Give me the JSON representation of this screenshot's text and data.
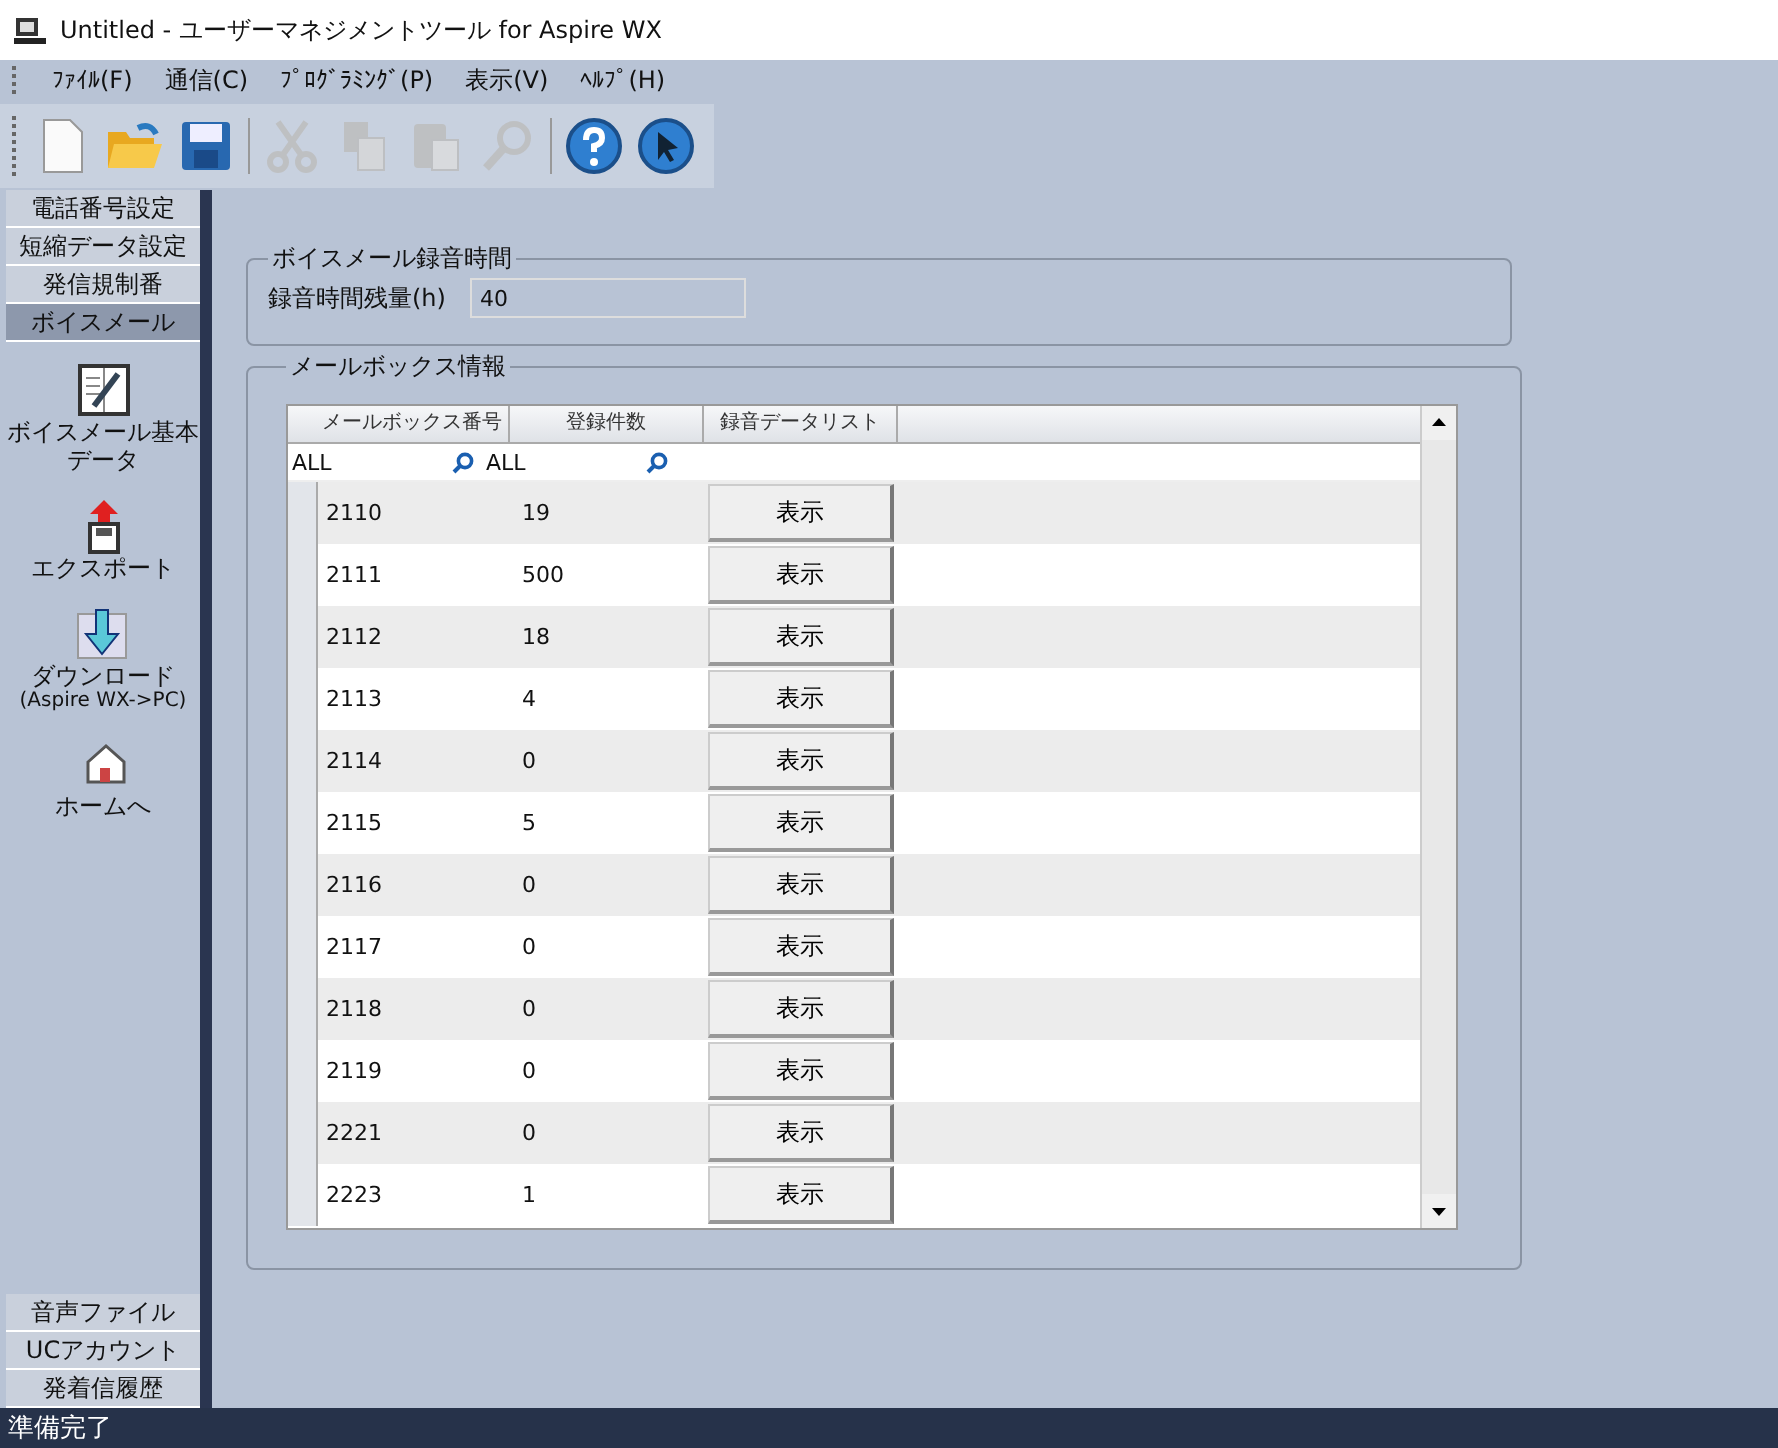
{
  "window": {
    "title": "Untitled - ユーザーマネジメントツール for Aspire WX"
  },
  "menu": [
    "ﾌｧｲﾙ(F)",
    "通信(C)",
    "ﾌﾟﾛｸﾞﾗﾐﾝｸﾞ(P)",
    "表示(V)",
    "ﾍﾙﾌﾟ(H)"
  ],
  "toolbar": [
    {
      "kind": "new",
      "disabled": false
    },
    {
      "kind": "open",
      "disabled": false
    },
    {
      "kind": "save",
      "disabled": false
    },
    {
      "kind": "sep"
    },
    {
      "kind": "cut",
      "disabled": true
    },
    {
      "kind": "copy",
      "disabled": true
    },
    {
      "kind": "paste",
      "disabled": true
    },
    {
      "kind": "find",
      "disabled": true
    },
    {
      "kind": "sep"
    },
    {
      "kind": "help",
      "disabled": false
    },
    {
      "kind": "pointer",
      "disabled": false
    }
  ],
  "sidebar": {
    "top_tabs": [
      {
        "label": "電話番号設定",
        "selected": false
      },
      {
        "label": "短縮データ設定",
        "selected": false
      },
      {
        "label": "発信規制番",
        "selected": false
      },
      {
        "label": "ボイスメール",
        "selected": true
      }
    ],
    "items": [
      {
        "kind": "book",
        "label": "ボイスメール基本データ"
      },
      {
        "kind": "export",
        "label": "エクスポート"
      },
      {
        "kind": "download",
        "label": "ダウンロード",
        "sublabel": "(Aspire WX->PC)"
      },
      {
        "kind": "home",
        "label": "ホームへ"
      }
    ],
    "bottom_tabs": [
      {
        "label": "音声ファイル",
        "selected": false
      },
      {
        "label": "UCアカウント",
        "selected": false
      },
      {
        "label": "発着信履歴",
        "selected": false
      }
    ]
  },
  "recording_time": {
    "title": "ボイスメール録音時間",
    "label": "録音時間残量(h)",
    "value": "40"
  },
  "mailbox": {
    "title": "メールボックス情報",
    "columns": [
      "メールボックス番号",
      "登録件数",
      "録音データリスト"
    ],
    "filters": [
      "ALL",
      "ALL"
    ],
    "rows": [
      {
        "number": "2110",
        "count": "19",
        "action": "表示"
      },
      {
        "number": "2111",
        "count": "500",
        "action": "表示"
      },
      {
        "number": "2112",
        "count": "18",
        "action": "表示"
      },
      {
        "number": "2113",
        "count": "4",
        "action": "表示"
      },
      {
        "number": "2114",
        "count": "0",
        "action": "表示"
      },
      {
        "number": "2115",
        "count": "5",
        "action": "表示"
      },
      {
        "number": "2116",
        "count": "0",
        "action": "表示"
      },
      {
        "number": "2117",
        "count": "0",
        "action": "表示"
      },
      {
        "number": "2118",
        "count": "0",
        "action": "表示"
      },
      {
        "number": "2119",
        "count": "0",
        "action": "表示"
      },
      {
        "number": "2221",
        "count": "0",
        "action": "表示"
      },
      {
        "number": "2223",
        "count": "1",
        "action": "表示"
      }
    ]
  },
  "status_bar": "準備完了"
}
